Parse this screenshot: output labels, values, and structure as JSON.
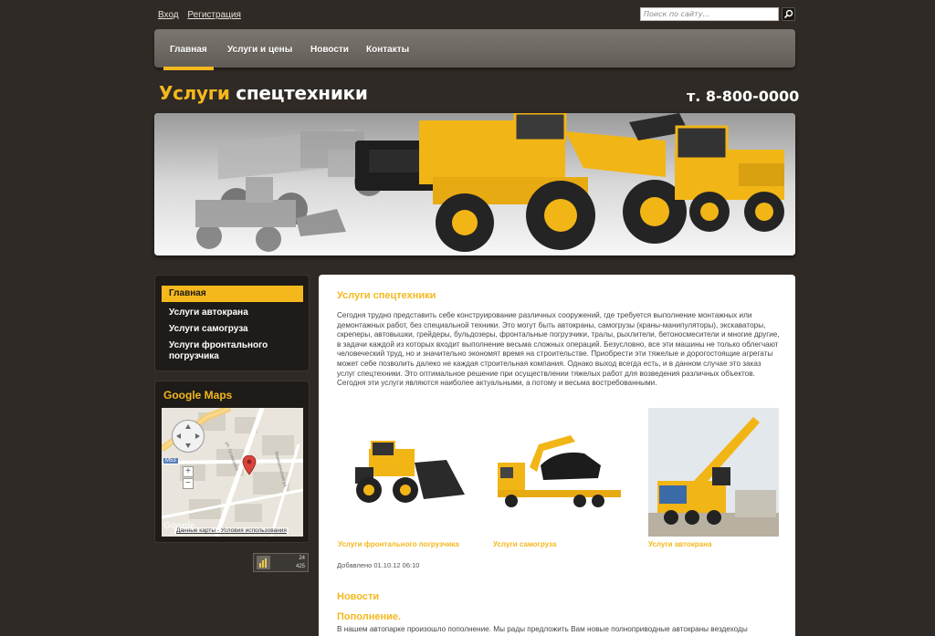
{
  "header": {
    "login": "Вход",
    "register": "Регистрация",
    "search_placeholder": "Поиск по сайту...",
    "logo_accent": "Услуги",
    "logo_rest": " спецтехники",
    "phone": "т. 8-800-0000"
  },
  "nav": {
    "items": [
      "Главная",
      "Услуги и цены",
      "Новости",
      "Контакты"
    ],
    "active": "Главная"
  },
  "sidebar": {
    "items": [
      "Главная",
      "Услуги автокрана",
      "Услуги самогруза",
      "Услуги фронтального погрузчика"
    ],
    "maps_title": "Google Maps",
    "map_street_1": "ул. Гусинского",
    "map_street_2": "Камышинская ул.",
    "map_shield": "M53",
    "map_links": "Данные карты - Условия использования",
    "map_brand": "Google",
    "counter_line_1": "24",
    "counter_line_2": "425"
  },
  "content": {
    "title": "Услуги спецтехники",
    "body": "Сегодня трудно представить себе конструирование различных сооружений, где требуется выполнение монтажных или демонтажных работ, без специальной техники. Это могут быть автокраны, самогрузы (краны-манипуляторы), экскаваторы, скреперы, автовышки, грейдеры, бульдозеры, фронтальные погрузчики, тралы, рыхлители, бетоносмесители и многие другие, в задачи каждой из которых входит выполнение весьма сложных операций. Безусловно, все эти машины не только облегчают человеческий труд, но и значительно экономят время на строительстве. Приобрести эти тяжелые и дорогостоящие агрегаты может себе позволить далеко не каждая строительная компания. Однако выход всегда есть, и в данном случае это заказ услуг спецтехники. Это оптимальное решение при осуществлении тяжелых работ для возведения различных объектов. Сегодня эти услуги являются наиболее актуальными, а потому и весьма востребованными.",
    "thumbs": [
      {
        "caption": "Услуги фронтального погрузчика"
      },
      {
        "caption": "Услуги самогруза"
      },
      {
        "caption": "Услуги автокрана"
      }
    ],
    "added": "Добавлено 01.10.12 06:10",
    "news_title": "Новости",
    "news_sub": "Пополнение.",
    "news_text": "В нашем автопарке произошло пополнение. Мы рады предложить Вам новые полноприводные автокраны вездеходы"
  },
  "colors": {
    "accent": "#f4b81d",
    "background": "#2f2a25"
  }
}
